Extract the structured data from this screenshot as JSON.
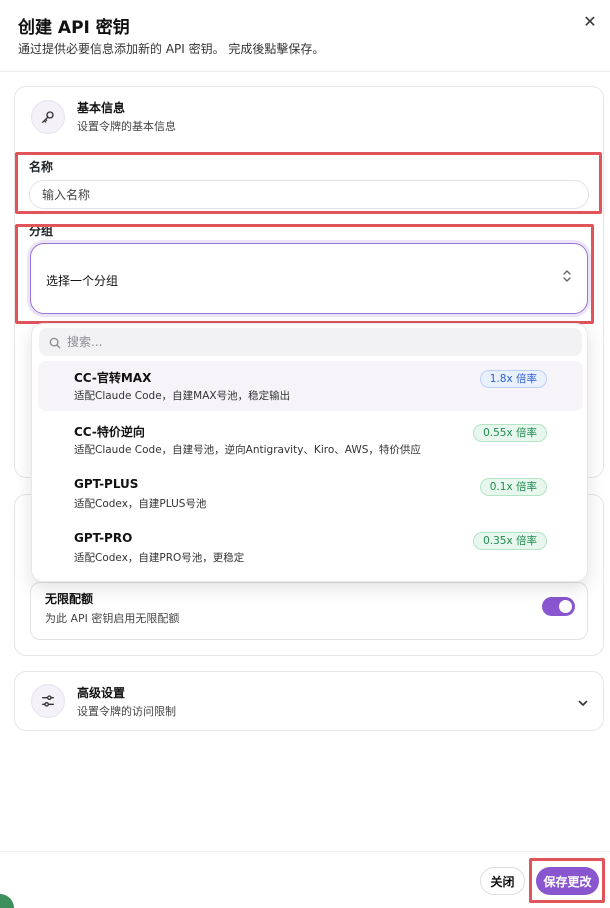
{
  "dialog": {
    "title": "创建 API 密钥",
    "subtitle": "通过提供必要信息添加新的 API 密钥。 完成後點擊保存。"
  },
  "basic_section": {
    "title": "基本信息",
    "subtitle": "设置令牌的基本信息",
    "icon": "key-icon"
  },
  "name_field": {
    "label": "名称",
    "placeholder": "输入名称"
  },
  "group_field": {
    "label": "分组",
    "placeholder": "选择一个分组"
  },
  "dropdown": {
    "search_placeholder": "搜索...",
    "options": [
      {
        "name": "CC-官转MAX",
        "desc": "适配Claude Code，自建MAX号池，稳定输出",
        "badge": "1.8x 倍率",
        "badge_color": "#2f5fd0"
      },
      {
        "name": "CC-特价逆向",
        "desc": "适配Claude Code，自建号池，逆向Antigravity、Kiro、AWS，特价供应",
        "badge": "0.55x 倍率",
        "badge_color": "#208a4f"
      },
      {
        "name": "GPT-PLUS",
        "desc": "适配Codex，自建PLUS号池",
        "badge": "0.1x 倍率",
        "badge_color": "#208a4f"
      },
      {
        "name": "GPT-PRO",
        "desc": "适配Codex，自建PRO号池，更稳定",
        "badge": "0.35x 倍率",
        "badge_color": "#208a4f"
      }
    ]
  },
  "unlimited": {
    "title": "无限配额",
    "subtitle": "为此 API 密钥启用无限配额",
    "enabled": true
  },
  "advanced_section": {
    "title": "高级设置",
    "subtitle": "设置令牌的访问限制",
    "icon": "sliders-icon"
  },
  "footer": {
    "close_label": "关闭",
    "save_label": "保存更改"
  },
  "colors": {
    "accent": "#8a56cf",
    "highlight": "#e0545a"
  }
}
